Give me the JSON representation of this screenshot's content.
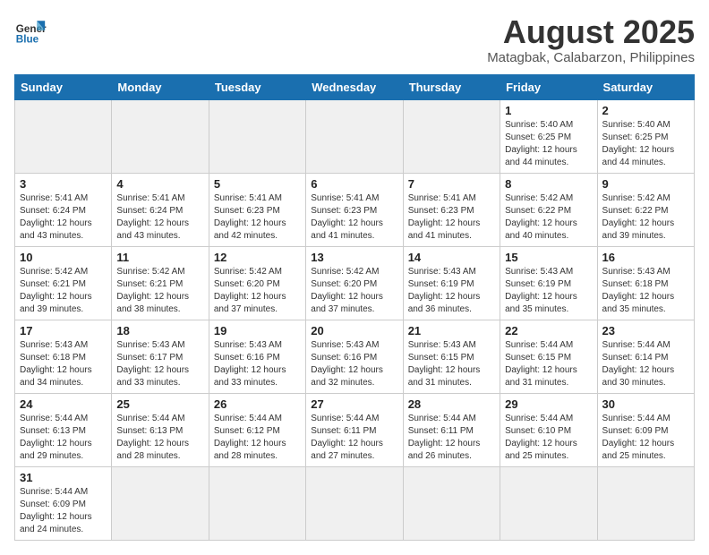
{
  "header": {
    "logo_general": "General",
    "logo_blue": "Blue",
    "title": "August 2025",
    "subtitle": "Matagbak, Calabarzon, Philippines"
  },
  "weekdays": [
    "Sunday",
    "Monday",
    "Tuesday",
    "Wednesday",
    "Thursday",
    "Friday",
    "Saturday"
  ],
  "weeks": [
    [
      {
        "day": "",
        "empty": true
      },
      {
        "day": "",
        "empty": true
      },
      {
        "day": "",
        "empty": true
      },
      {
        "day": "",
        "empty": true
      },
      {
        "day": "",
        "empty": true
      },
      {
        "day": "1",
        "sunrise": "5:40 AM",
        "sunset": "6:25 PM",
        "daylight": "12 hours and 44 minutes."
      },
      {
        "day": "2",
        "sunrise": "5:40 AM",
        "sunset": "6:25 PM",
        "daylight": "12 hours and 44 minutes."
      }
    ],
    [
      {
        "day": "3",
        "sunrise": "5:41 AM",
        "sunset": "6:24 PM",
        "daylight": "12 hours and 43 minutes."
      },
      {
        "day": "4",
        "sunrise": "5:41 AM",
        "sunset": "6:24 PM",
        "daylight": "12 hours and 43 minutes."
      },
      {
        "day": "5",
        "sunrise": "5:41 AM",
        "sunset": "6:23 PM",
        "daylight": "12 hours and 42 minutes."
      },
      {
        "day": "6",
        "sunrise": "5:41 AM",
        "sunset": "6:23 PM",
        "daylight": "12 hours and 41 minutes."
      },
      {
        "day": "7",
        "sunrise": "5:41 AM",
        "sunset": "6:23 PM",
        "daylight": "12 hours and 41 minutes."
      },
      {
        "day": "8",
        "sunrise": "5:42 AM",
        "sunset": "6:22 PM",
        "daylight": "12 hours and 40 minutes."
      },
      {
        "day": "9",
        "sunrise": "5:42 AM",
        "sunset": "6:22 PM",
        "daylight": "12 hours and 39 minutes."
      }
    ],
    [
      {
        "day": "10",
        "sunrise": "5:42 AM",
        "sunset": "6:21 PM",
        "daylight": "12 hours and 39 minutes."
      },
      {
        "day": "11",
        "sunrise": "5:42 AM",
        "sunset": "6:21 PM",
        "daylight": "12 hours and 38 minutes."
      },
      {
        "day": "12",
        "sunrise": "5:42 AM",
        "sunset": "6:20 PM",
        "daylight": "12 hours and 37 minutes."
      },
      {
        "day": "13",
        "sunrise": "5:42 AM",
        "sunset": "6:20 PM",
        "daylight": "12 hours and 37 minutes."
      },
      {
        "day": "14",
        "sunrise": "5:43 AM",
        "sunset": "6:19 PM",
        "daylight": "12 hours and 36 minutes."
      },
      {
        "day": "15",
        "sunrise": "5:43 AM",
        "sunset": "6:19 PM",
        "daylight": "12 hours and 35 minutes."
      },
      {
        "day": "16",
        "sunrise": "5:43 AM",
        "sunset": "6:18 PM",
        "daylight": "12 hours and 35 minutes."
      }
    ],
    [
      {
        "day": "17",
        "sunrise": "5:43 AM",
        "sunset": "6:18 PM",
        "daylight": "12 hours and 34 minutes."
      },
      {
        "day": "18",
        "sunrise": "5:43 AM",
        "sunset": "6:17 PM",
        "daylight": "12 hours and 33 minutes."
      },
      {
        "day": "19",
        "sunrise": "5:43 AM",
        "sunset": "6:16 PM",
        "daylight": "12 hours and 33 minutes."
      },
      {
        "day": "20",
        "sunrise": "5:43 AM",
        "sunset": "6:16 PM",
        "daylight": "12 hours and 32 minutes."
      },
      {
        "day": "21",
        "sunrise": "5:43 AM",
        "sunset": "6:15 PM",
        "daylight": "12 hours and 31 minutes."
      },
      {
        "day": "22",
        "sunrise": "5:44 AM",
        "sunset": "6:15 PM",
        "daylight": "12 hours and 31 minutes."
      },
      {
        "day": "23",
        "sunrise": "5:44 AM",
        "sunset": "6:14 PM",
        "daylight": "12 hours and 30 minutes."
      }
    ],
    [
      {
        "day": "24",
        "sunrise": "5:44 AM",
        "sunset": "6:13 PM",
        "daylight": "12 hours and 29 minutes."
      },
      {
        "day": "25",
        "sunrise": "5:44 AM",
        "sunset": "6:13 PM",
        "daylight": "12 hours and 28 minutes."
      },
      {
        "day": "26",
        "sunrise": "5:44 AM",
        "sunset": "6:12 PM",
        "daylight": "12 hours and 28 minutes."
      },
      {
        "day": "27",
        "sunrise": "5:44 AM",
        "sunset": "6:11 PM",
        "daylight": "12 hours and 27 minutes."
      },
      {
        "day": "28",
        "sunrise": "5:44 AM",
        "sunset": "6:11 PM",
        "daylight": "12 hours and 26 minutes."
      },
      {
        "day": "29",
        "sunrise": "5:44 AM",
        "sunset": "6:10 PM",
        "daylight": "12 hours and 25 minutes."
      },
      {
        "day": "30",
        "sunrise": "5:44 AM",
        "sunset": "6:09 PM",
        "daylight": "12 hours and 25 minutes."
      }
    ],
    [
      {
        "day": "31",
        "sunrise": "5:44 AM",
        "sunset": "6:09 PM",
        "daylight": "12 hours and 24 minutes."
      },
      {
        "day": "",
        "empty": true
      },
      {
        "day": "",
        "empty": true
      },
      {
        "day": "",
        "empty": true
      },
      {
        "day": "",
        "empty": true
      },
      {
        "day": "",
        "empty": true
      },
      {
        "day": "",
        "empty": true
      }
    ]
  ]
}
